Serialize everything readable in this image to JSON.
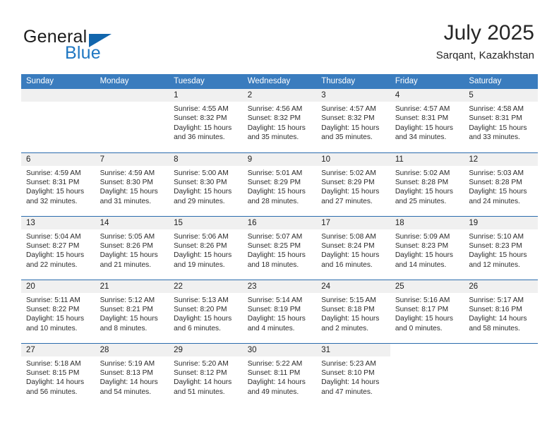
{
  "logo": {
    "text_top": "General",
    "text_bottom": "Blue",
    "accent_color": "#1266ad",
    "blue_text_color": "#1f77c2"
  },
  "header": {
    "title": "July 2025",
    "location": "Sarqant, Kazakhstan"
  },
  "theme": {
    "header_bar_color": "#3a7cbe",
    "row_divider_color": "#2b6cad",
    "daynum_strip_color": "#f0f0f0",
    "page_background": "#ffffff"
  },
  "calendar": {
    "weekday_headers": [
      "Sunday",
      "Monday",
      "Tuesday",
      "Wednesday",
      "Thursday",
      "Friday",
      "Saturday"
    ],
    "labels": {
      "sunrise": "Sunrise:",
      "sunset": "Sunset:",
      "daylight": "Daylight:"
    },
    "weeks": [
      [
        {
          "day": "",
          "empty": true
        },
        {
          "day": "",
          "empty": true
        },
        {
          "day": "1",
          "sunrise": "Sunrise: 4:55 AM",
          "sunset": "Sunset: 8:32 PM",
          "daylight": "Daylight: 15 hours and 36 minutes."
        },
        {
          "day": "2",
          "sunrise": "Sunrise: 4:56 AM",
          "sunset": "Sunset: 8:32 PM",
          "daylight": "Daylight: 15 hours and 35 minutes."
        },
        {
          "day": "3",
          "sunrise": "Sunrise: 4:57 AM",
          "sunset": "Sunset: 8:32 PM",
          "daylight": "Daylight: 15 hours and 35 minutes."
        },
        {
          "day": "4",
          "sunrise": "Sunrise: 4:57 AM",
          "sunset": "Sunset: 8:31 PM",
          "daylight": "Daylight: 15 hours and 34 minutes."
        },
        {
          "day": "5",
          "sunrise": "Sunrise: 4:58 AM",
          "sunset": "Sunset: 8:31 PM",
          "daylight": "Daylight: 15 hours and 33 minutes."
        }
      ],
      [
        {
          "day": "6",
          "sunrise": "Sunrise: 4:59 AM",
          "sunset": "Sunset: 8:31 PM",
          "daylight": "Daylight: 15 hours and 32 minutes."
        },
        {
          "day": "7",
          "sunrise": "Sunrise: 4:59 AM",
          "sunset": "Sunset: 8:30 PM",
          "daylight": "Daylight: 15 hours and 31 minutes."
        },
        {
          "day": "8",
          "sunrise": "Sunrise: 5:00 AM",
          "sunset": "Sunset: 8:30 PM",
          "daylight": "Daylight: 15 hours and 29 minutes."
        },
        {
          "day": "9",
          "sunrise": "Sunrise: 5:01 AM",
          "sunset": "Sunset: 8:29 PM",
          "daylight": "Daylight: 15 hours and 28 minutes."
        },
        {
          "day": "10",
          "sunrise": "Sunrise: 5:02 AM",
          "sunset": "Sunset: 8:29 PM",
          "daylight": "Daylight: 15 hours and 27 minutes."
        },
        {
          "day": "11",
          "sunrise": "Sunrise: 5:02 AM",
          "sunset": "Sunset: 8:28 PM",
          "daylight": "Daylight: 15 hours and 25 minutes."
        },
        {
          "day": "12",
          "sunrise": "Sunrise: 5:03 AM",
          "sunset": "Sunset: 8:28 PM",
          "daylight": "Daylight: 15 hours and 24 minutes."
        }
      ],
      [
        {
          "day": "13",
          "sunrise": "Sunrise: 5:04 AM",
          "sunset": "Sunset: 8:27 PM",
          "daylight": "Daylight: 15 hours and 22 minutes."
        },
        {
          "day": "14",
          "sunrise": "Sunrise: 5:05 AM",
          "sunset": "Sunset: 8:26 PM",
          "daylight": "Daylight: 15 hours and 21 minutes."
        },
        {
          "day": "15",
          "sunrise": "Sunrise: 5:06 AM",
          "sunset": "Sunset: 8:26 PM",
          "daylight": "Daylight: 15 hours and 19 minutes."
        },
        {
          "day": "16",
          "sunrise": "Sunrise: 5:07 AM",
          "sunset": "Sunset: 8:25 PM",
          "daylight": "Daylight: 15 hours and 18 minutes."
        },
        {
          "day": "17",
          "sunrise": "Sunrise: 5:08 AM",
          "sunset": "Sunset: 8:24 PM",
          "daylight": "Daylight: 15 hours and 16 minutes."
        },
        {
          "day": "18",
          "sunrise": "Sunrise: 5:09 AM",
          "sunset": "Sunset: 8:23 PM",
          "daylight": "Daylight: 15 hours and 14 minutes."
        },
        {
          "day": "19",
          "sunrise": "Sunrise: 5:10 AM",
          "sunset": "Sunset: 8:23 PM",
          "daylight": "Daylight: 15 hours and 12 minutes."
        }
      ],
      [
        {
          "day": "20",
          "sunrise": "Sunrise: 5:11 AM",
          "sunset": "Sunset: 8:22 PM",
          "daylight": "Daylight: 15 hours and 10 minutes."
        },
        {
          "day": "21",
          "sunrise": "Sunrise: 5:12 AM",
          "sunset": "Sunset: 8:21 PM",
          "daylight": "Daylight: 15 hours and 8 minutes."
        },
        {
          "day": "22",
          "sunrise": "Sunrise: 5:13 AM",
          "sunset": "Sunset: 8:20 PM",
          "daylight": "Daylight: 15 hours and 6 minutes."
        },
        {
          "day": "23",
          "sunrise": "Sunrise: 5:14 AM",
          "sunset": "Sunset: 8:19 PM",
          "daylight": "Daylight: 15 hours and 4 minutes."
        },
        {
          "day": "24",
          "sunrise": "Sunrise: 5:15 AM",
          "sunset": "Sunset: 8:18 PM",
          "daylight": "Daylight: 15 hours and 2 minutes."
        },
        {
          "day": "25",
          "sunrise": "Sunrise: 5:16 AM",
          "sunset": "Sunset: 8:17 PM",
          "daylight": "Daylight: 15 hours and 0 minutes."
        },
        {
          "day": "26",
          "sunrise": "Sunrise: 5:17 AM",
          "sunset": "Sunset: 8:16 PM",
          "daylight": "Daylight: 14 hours and 58 minutes."
        }
      ],
      [
        {
          "day": "27",
          "sunrise": "Sunrise: 5:18 AM",
          "sunset": "Sunset: 8:15 PM",
          "daylight": "Daylight: 14 hours and 56 minutes."
        },
        {
          "day": "28",
          "sunrise": "Sunrise: 5:19 AM",
          "sunset": "Sunset: 8:13 PM",
          "daylight": "Daylight: 14 hours and 54 minutes."
        },
        {
          "day": "29",
          "sunrise": "Sunrise: 5:20 AM",
          "sunset": "Sunset: 8:12 PM",
          "daylight": "Daylight: 14 hours and 51 minutes."
        },
        {
          "day": "30",
          "sunrise": "Sunrise: 5:22 AM",
          "sunset": "Sunset: 8:11 PM",
          "daylight": "Daylight: 14 hours and 49 minutes."
        },
        {
          "day": "31",
          "sunrise": "Sunrise: 5:23 AM",
          "sunset": "Sunset: 8:10 PM",
          "daylight": "Daylight: 14 hours and 47 minutes."
        },
        {
          "day": "",
          "blank": true
        },
        {
          "day": "",
          "blank": true
        }
      ]
    ]
  }
}
